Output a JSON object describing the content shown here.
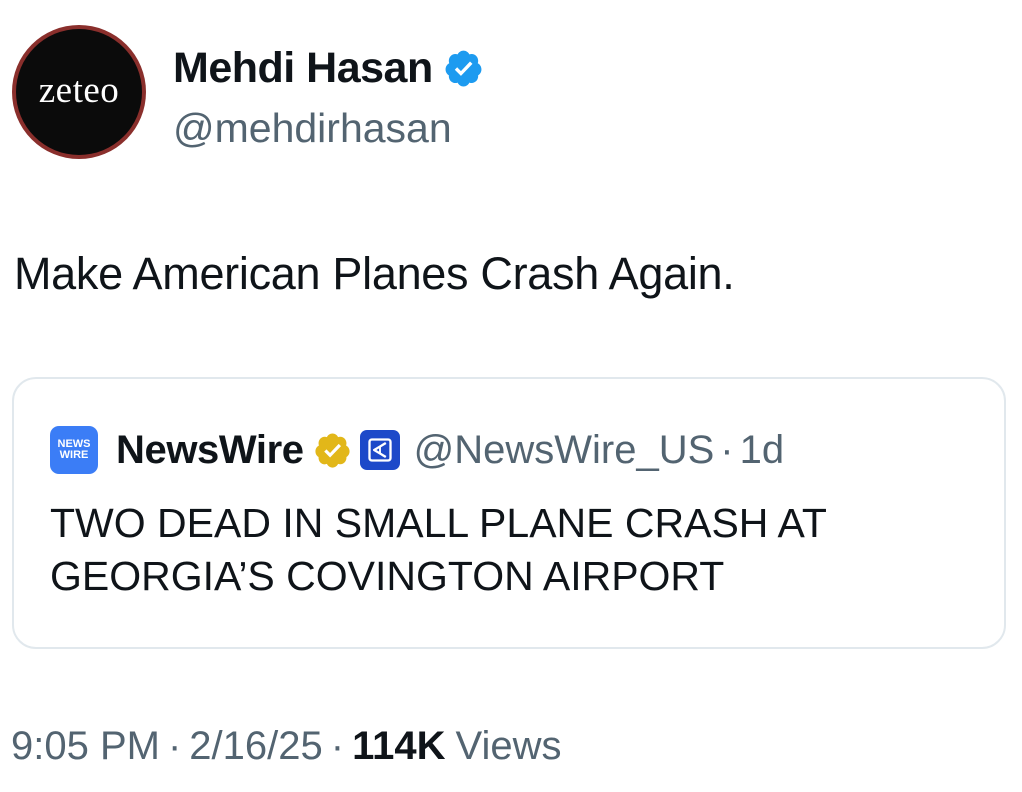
{
  "author": {
    "avatar_text": "zeteo",
    "display_name": "Mehdi Hasan",
    "handle": "@mehdirhasan",
    "verified_icon": "verified-blue-check-icon"
  },
  "tweet": {
    "text": "Make American Planes Crash Again."
  },
  "quote": {
    "avatar_line1": "NEWS",
    "avatar_line2": "WIRE",
    "display_name": "NewsWire",
    "handle": "@NewsWire_US",
    "separator": "·",
    "time": "1d",
    "text": "TWO DEAD IN SMALL PLANE CRASH AT GEORGIA’S COVINGTON AIRPORT",
    "badge_icon": "gold-verified-check-icon",
    "affiliate_icon": "affiliate-badge-icon"
  },
  "meta": {
    "time": "9:05 PM",
    "date": "2/16/25",
    "views_count": "114K",
    "views_label": "Views",
    "separator": "·"
  },
  "colors": {
    "text_primary": "#0f1419",
    "text_secondary": "#536471",
    "verified_blue": "#1d9bf0",
    "gold_badge": "#e2b719",
    "card_border": "#e1e8ed",
    "avatar_ring": "#8a2f2c",
    "newswire_blue": "#3b7df6"
  }
}
